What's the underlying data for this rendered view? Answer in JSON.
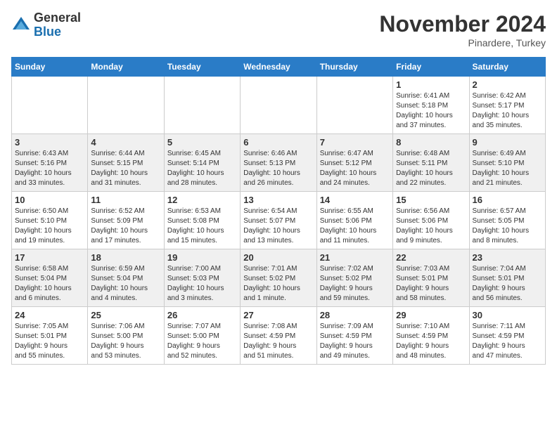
{
  "header": {
    "logo_general": "General",
    "logo_blue": "Blue",
    "month_title": "November 2024",
    "location": "Pinardere, Turkey"
  },
  "days_of_week": [
    "Sunday",
    "Monday",
    "Tuesday",
    "Wednesday",
    "Thursday",
    "Friday",
    "Saturday"
  ],
  "weeks": [
    [
      {
        "day": "",
        "info": ""
      },
      {
        "day": "",
        "info": ""
      },
      {
        "day": "",
        "info": ""
      },
      {
        "day": "",
        "info": ""
      },
      {
        "day": "",
        "info": ""
      },
      {
        "day": "1",
        "info": "Sunrise: 6:41 AM\nSunset: 5:18 PM\nDaylight: 10 hours\nand 37 minutes."
      },
      {
        "day": "2",
        "info": "Sunrise: 6:42 AM\nSunset: 5:17 PM\nDaylight: 10 hours\nand 35 minutes."
      }
    ],
    [
      {
        "day": "3",
        "info": "Sunrise: 6:43 AM\nSunset: 5:16 PM\nDaylight: 10 hours\nand 33 minutes."
      },
      {
        "day": "4",
        "info": "Sunrise: 6:44 AM\nSunset: 5:15 PM\nDaylight: 10 hours\nand 31 minutes."
      },
      {
        "day": "5",
        "info": "Sunrise: 6:45 AM\nSunset: 5:14 PM\nDaylight: 10 hours\nand 28 minutes."
      },
      {
        "day": "6",
        "info": "Sunrise: 6:46 AM\nSunset: 5:13 PM\nDaylight: 10 hours\nand 26 minutes."
      },
      {
        "day": "7",
        "info": "Sunrise: 6:47 AM\nSunset: 5:12 PM\nDaylight: 10 hours\nand 24 minutes."
      },
      {
        "day": "8",
        "info": "Sunrise: 6:48 AM\nSunset: 5:11 PM\nDaylight: 10 hours\nand 22 minutes."
      },
      {
        "day": "9",
        "info": "Sunrise: 6:49 AM\nSunset: 5:10 PM\nDaylight: 10 hours\nand 21 minutes."
      }
    ],
    [
      {
        "day": "10",
        "info": "Sunrise: 6:50 AM\nSunset: 5:10 PM\nDaylight: 10 hours\nand 19 minutes."
      },
      {
        "day": "11",
        "info": "Sunrise: 6:52 AM\nSunset: 5:09 PM\nDaylight: 10 hours\nand 17 minutes."
      },
      {
        "day": "12",
        "info": "Sunrise: 6:53 AM\nSunset: 5:08 PM\nDaylight: 10 hours\nand 15 minutes."
      },
      {
        "day": "13",
        "info": "Sunrise: 6:54 AM\nSunset: 5:07 PM\nDaylight: 10 hours\nand 13 minutes."
      },
      {
        "day": "14",
        "info": "Sunrise: 6:55 AM\nSunset: 5:06 PM\nDaylight: 10 hours\nand 11 minutes."
      },
      {
        "day": "15",
        "info": "Sunrise: 6:56 AM\nSunset: 5:06 PM\nDaylight: 10 hours\nand 9 minutes."
      },
      {
        "day": "16",
        "info": "Sunrise: 6:57 AM\nSunset: 5:05 PM\nDaylight: 10 hours\nand 8 minutes."
      }
    ],
    [
      {
        "day": "17",
        "info": "Sunrise: 6:58 AM\nSunset: 5:04 PM\nDaylight: 10 hours\nand 6 minutes."
      },
      {
        "day": "18",
        "info": "Sunrise: 6:59 AM\nSunset: 5:04 PM\nDaylight: 10 hours\nand 4 minutes."
      },
      {
        "day": "19",
        "info": "Sunrise: 7:00 AM\nSunset: 5:03 PM\nDaylight: 10 hours\nand 3 minutes."
      },
      {
        "day": "20",
        "info": "Sunrise: 7:01 AM\nSunset: 5:02 PM\nDaylight: 10 hours\nand 1 minute."
      },
      {
        "day": "21",
        "info": "Sunrise: 7:02 AM\nSunset: 5:02 PM\nDaylight: 9 hours\nand 59 minutes."
      },
      {
        "day": "22",
        "info": "Sunrise: 7:03 AM\nSunset: 5:01 PM\nDaylight: 9 hours\nand 58 minutes."
      },
      {
        "day": "23",
        "info": "Sunrise: 7:04 AM\nSunset: 5:01 PM\nDaylight: 9 hours\nand 56 minutes."
      }
    ],
    [
      {
        "day": "24",
        "info": "Sunrise: 7:05 AM\nSunset: 5:01 PM\nDaylight: 9 hours\nand 55 minutes."
      },
      {
        "day": "25",
        "info": "Sunrise: 7:06 AM\nSunset: 5:00 PM\nDaylight: 9 hours\nand 53 minutes."
      },
      {
        "day": "26",
        "info": "Sunrise: 7:07 AM\nSunset: 5:00 PM\nDaylight: 9 hours\nand 52 minutes."
      },
      {
        "day": "27",
        "info": "Sunrise: 7:08 AM\nSunset: 4:59 PM\nDaylight: 9 hours\nand 51 minutes."
      },
      {
        "day": "28",
        "info": "Sunrise: 7:09 AM\nSunset: 4:59 PM\nDaylight: 9 hours\nand 49 minutes."
      },
      {
        "day": "29",
        "info": "Sunrise: 7:10 AM\nSunset: 4:59 PM\nDaylight: 9 hours\nand 48 minutes."
      },
      {
        "day": "30",
        "info": "Sunrise: 7:11 AM\nSunset: 4:59 PM\nDaylight: 9 hours\nand 47 minutes."
      }
    ]
  ]
}
